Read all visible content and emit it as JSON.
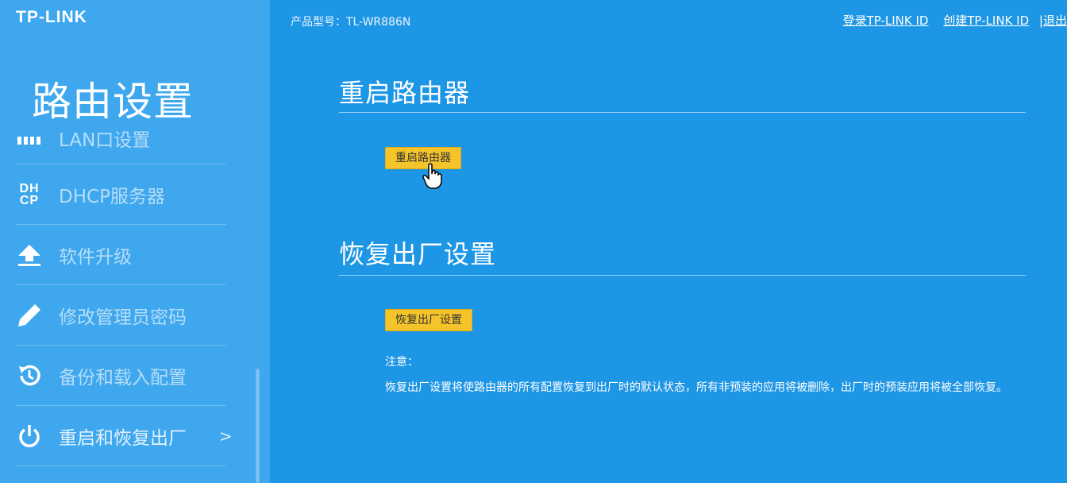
{
  "brand": {
    "logo_text": "TP-LINK"
  },
  "header": {
    "model_text": "产品型号：TL-WR886N",
    "links": {
      "login": "登录TP-LINK ID",
      "create": "创建TP-LINK ID",
      "logout": "退出"
    }
  },
  "sidebar": {
    "title": "路由设置",
    "items": [
      {
        "label": "LAN口设置",
        "icon": "lan-icon"
      },
      {
        "label": "DHCP服务器",
        "icon": "dhcp-icon",
        "icon_text_top": "DH",
        "icon_text_bottom": "CP"
      },
      {
        "label": "软件升级",
        "icon": "upload-icon"
      },
      {
        "label": "修改管理员密码",
        "icon": "pencil-icon"
      },
      {
        "label": "备份和载入配置",
        "icon": "history-icon"
      },
      {
        "label": "重启和恢复出厂",
        "icon": "power-icon",
        "active": true,
        "suffix": ">"
      }
    ]
  },
  "main": {
    "reboot": {
      "heading": "重启路由器",
      "button_label": "重启路由器"
    },
    "factory_reset": {
      "heading": "恢复出厂设置",
      "button_label": "恢复出厂设置",
      "note_title": "注意：",
      "note_text": "恢复出厂设置将使路由器的所有配置恢复到出厂时的默认状态，所有非预装的应用将被删除，出厂时的预装应用将被全部恢复。"
    }
  },
  "colors": {
    "main_background": "#1e96e6",
    "sidebar_background": "#3ea7ee",
    "button_yellow": "#f5c42b"
  }
}
